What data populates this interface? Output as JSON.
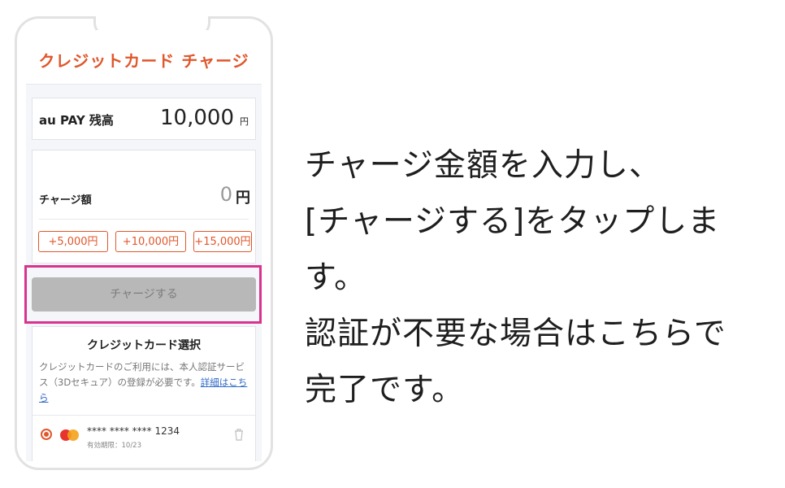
{
  "screen": {
    "title": "クレジットカード チャージ",
    "balance": {
      "label": "au PAY 残高",
      "value": "10,000",
      "unit": "円"
    },
    "charge": {
      "label": "チャージ額",
      "value": "0",
      "unit": "円",
      "quick_amounts": [
        "+5,000円",
        "+10,000円",
        "+15,000円"
      ]
    },
    "charge_button_label": "チャージする",
    "credit_card": {
      "heading": "クレジットカード選択",
      "description": "クレジットカードのご利用には、本人認証サービス（3Dセキュア）の登録が必要です。",
      "link_text": "詳細はこちら",
      "card_number": "**** **** **** 1234",
      "expiry": "有効期限：10/23",
      "brand_icon": "mastercard-icon",
      "delete_icon": "trash-icon"
    },
    "colors": {
      "accent": "#e0572b",
      "highlight": "#d9338f",
      "disabled_button": "#b8b8b8",
      "link": "#2f69c7"
    }
  },
  "instructions": {
    "line1": "チャージ金額を入力し、",
    "line2": "[チャージする]をタップしま",
    "line3": "す。",
    "line4": "認証が不要な場合はこちらで",
    "line5": "完了です。"
  }
}
